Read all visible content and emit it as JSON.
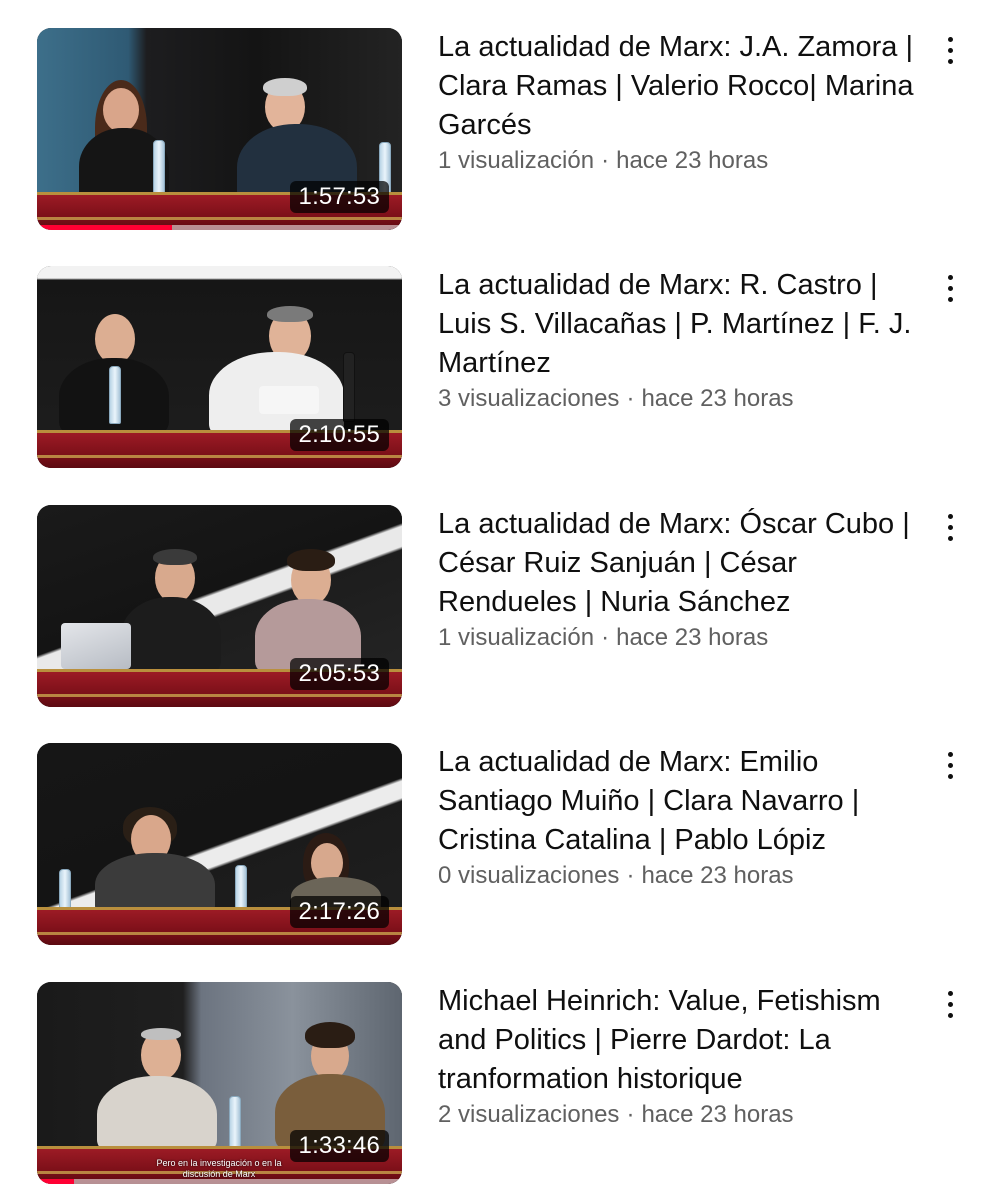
{
  "videos": [
    {
      "title": "La actualidad de Marx: J.A. Zamora | Clara Ramas | Valerio Rocco| Marina Garcés",
      "views": "1 visualización",
      "age": "hace 23 horas",
      "duration": "1:57:53",
      "watched_progress": 0.37,
      "menu_icon": "more-vert-icon"
    },
    {
      "title": "La actualidad de Marx: R. Castro | Luis S. Villacañas | P. Martínez | F. J. Martínez",
      "views": "3 visualizaciones",
      "age": "hace 23 horas",
      "duration": "2:10:55",
      "watched_progress": 0,
      "menu_icon": "more-vert-icon"
    },
    {
      "title": "La actualidad de Marx: Óscar Cubo | César Ruiz Sanjuán | César Rendueles | Nuria Sánchez",
      "views": "1 visualización",
      "age": "hace 23 horas",
      "duration": "2:05:53",
      "watched_progress": 0,
      "menu_icon": "more-vert-icon"
    },
    {
      "title": "La actualidad de Marx: Emilio Santiago Muiño | Clara Navarro | Cristina Catalina | Pablo Lópiz",
      "views": "0 visualizaciones",
      "age": "hace 23 horas",
      "duration": "2:17:26",
      "watched_progress": 0,
      "menu_icon": "more-vert-icon"
    },
    {
      "title": "Michael Heinrich: Value, Fetishism and Politics | Pierre Dardot: La tranformation historique",
      "views": "2 visualizaciones",
      "age": "hace 23 horas",
      "duration": "1:33:46",
      "watched_progress": 0.1,
      "subtitle_overlay": "Pero en la investigación o en la discusión de Marx",
      "menu_icon": "more-vert-icon"
    }
  ],
  "separator": "·",
  "colors": {
    "progress": "#ff0033",
    "meta_text": "#606060",
    "title_text": "#0f0f0f",
    "table_cloth": "#8b1520"
  }
}
